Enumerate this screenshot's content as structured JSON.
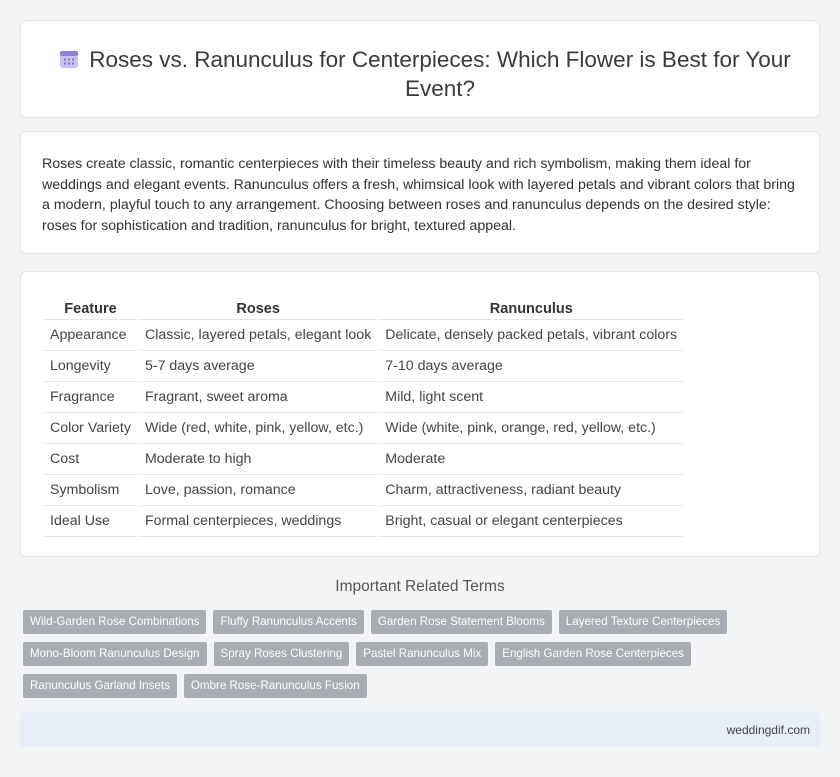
{
  "header": {
    "title": "Roses vs. Ranunculus for Centerpieces: Which Flower is Best for Your Event?",
    "icon": "calendar-icon"
  },
  "intro": {
    "text": "Roses create classic, romantic centerpieces with their timeless beauty and rich symbolism, making them ideal for weddings and elegant events. Ranunculus offers a fresh, whimsical look with layered petals and vibrant colors that bring a modern, playful touch to any arrangement. Choosing between roses and ranunculus depends on the desired style: roses for sophistication and tradition, ranunculus for bright, textured appeal."
  },
  "table": {
    "headers": [
      "Feature",
      "Roses",
      "Ranunculus"
    ],
    "rows": [
      [
        "Appearance",
        "Classic, layered petals, elegant look",
        "Delicate, densely packed petals, vibrant colors"
      ],
      [
        "Longevity",
        "5-7 days average",
        "7-10 days average"
      ],
      [
        "Fragrance",
        "Fragrant, sweet aroma",
        "Mild, light scent"
      ],
      [
        "Color Variety",
        "Wide (red, white, pink, yellow, etc.)",
        "Wide (white, pink, orange, red, yellow, etc.)"
      ],
      [
        "Cost",
        "Moderate to high",
        "Moderate"
      ],
      [
        "Symbolism",
        "Love, passion, romance",
        "Charm, attractiveness, radiant beauty"
      ],
      [
        "Ideal Use",
        "Formal centerpieces, weddings",
        "Bright, casual or elegant centerpieces"
      ]
    ]
  },
  "terms": {
    "title": "Important Related Terms",
    "items": [
      "Wild-Garden Rose Combinations",
      "Fluffy Ranunculus Accents",
      "Garden Rose Statement Blooms",
      "Layered Texture Centerpieces",
      "Mono-Bloom Ranunculus Design",
      "Spray Roses Clustering",
      "Pastel Ranunculus Mix",
      "English Garden Rose Centerpieces",
      "Ranunculus Garland Insets",
      "Ombre Rose-Ranunculus Fusion"
    ]
  },
  "footer": {
    "text": "weddingdif.com"
  },
  "colors": {
    "tag_bg": "#a9adb3",
    "footer_bg": "#e8eef7",
    "icon_accent": "#8b7fd6"
  }
}
